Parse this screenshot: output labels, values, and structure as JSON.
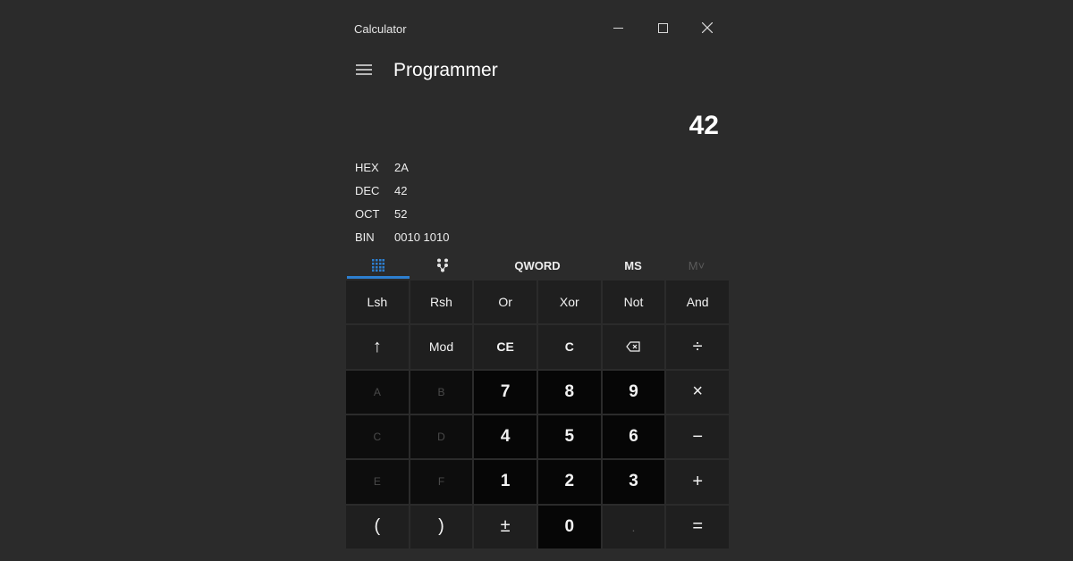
{
  "window": {
    "title": "Calculator",
    "controls": {
      "minimize_icon": "minimize-icon",
      "maximize_icon": "maximize-icon",
      "close_icon": "close-icon"
    }
  },
  "header": {
    "mode": "Programmer",
    "menu_icon": "hamburger-icon"
  },
  "display": {
    "value": "42"
  },
  "radix": [
    {
      "name": "HEX",
      "value": "2A"
    },
    {
      "name": "DEC",
      "value": "42"
    },
    {
      "name": "OCT",
      "value": "52"
    },
    {
      "name": "BIN",
      "value": "0010 1010"
    }
  ],
  "toolbar": {
    "keypad_icon": "keypad-grid-icon",
    "bit_toggle_icon": "bit-toggle-icon",
    "word_size": "QWORD",
    "memory_store": "MS",
    "memory_recall": "M˅"
  },
  "keys": {
    "row1": [
      "Lsh",
      "Rsh",
      "Or",
      "Xor",
      "Not",
      "And"
    ],
    "row2": [
      "↑",
      "Mod",
      "CE",
      "C",
      "⌫",
      "÷"
    ],
    "row3": [
      "A",
      "B",
      "7",
      "8",
      "9",
      "×"
    ],
    "row4": [
      "C",
      "D",
      "4",
      "5",
      "6",
      "−"
    ],
    "row5": [
      "E",
      "F",
      "1",
      "2",
      "3",
      "+"
    ],
    "row6": [
      "(",
      ")",
      "±",
      "0",
      ".",
      "="
    ]
  },
  "colors": {
    "background": "#2b2b2b",
    "accent": "#2d7fd0",
    "number_key": "#060606",
    "function_key": "#1f1f1f"
  }
}
